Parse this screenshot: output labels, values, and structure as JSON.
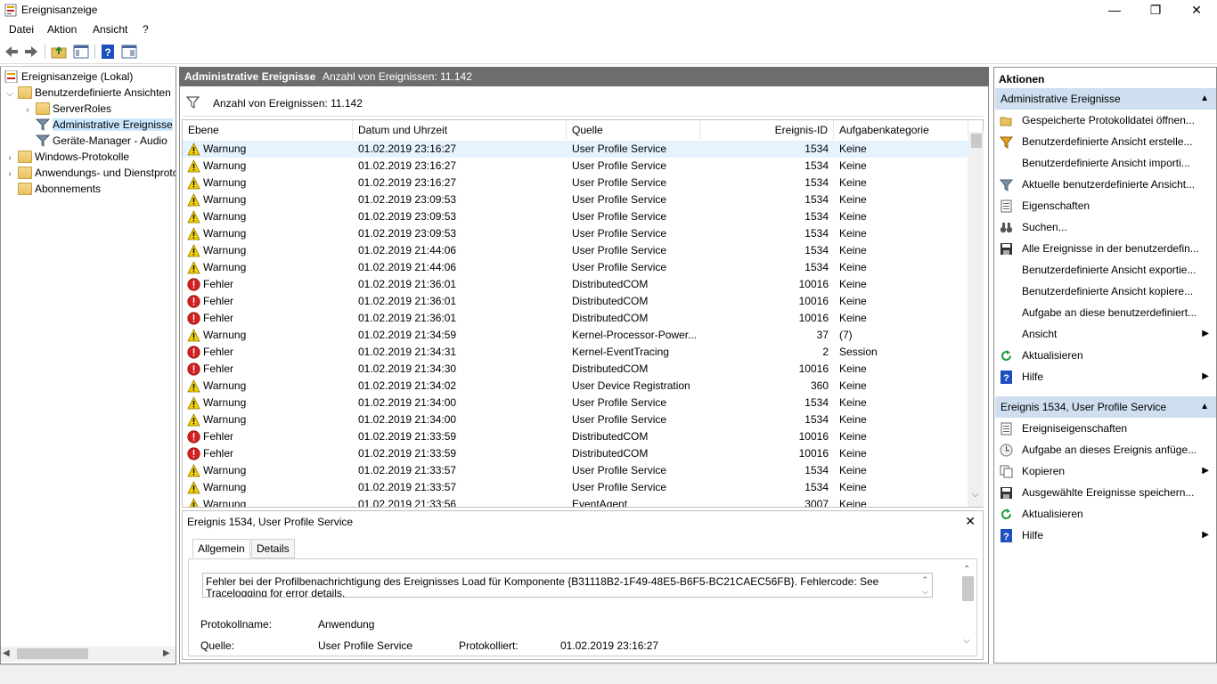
{
  "window": {
    "title": "Ereignisanzeige"
  },
  "menu": [
    "Datei",
    "Aktion",
    "Ansicht",
    "?"
  ],
  "tree": {
    "root": "Ereignisanzeige (Lokal)",
    "custom_views": "Benutzerdefinierte Ansichten",
    "server_roles": "ServerRoles",
    "admin_events": "Administrative Ereignisse",
    "device_manager": "Geräte-Manager - Audio",
    "windows_logs": "Windows-Protokolle",
    "app_logs": "Anwendungs- und Dienstprotokolle",
    "subscriptions": "Abonnements"
  },
  "center": {
    "title": "Administrative Ereignisse",
    "count_label": "Anzahl von Ereignissen: 11.142",
    "filter_text": "Anzahl von Ereignissen: 11.142",
    "columns": [
      "Ebene",
      "Datum und Uhrzeit",
      "Quelle",
      "Ereignis-ID",
      "Aufgabenkategorie"
    ],
    "rows": [
      {
        "level": "Warnung",
        "type": "warn",
        "date": "01.02.2019 23:16:27",
        "source": "User Profile Service",
        "id": "1534",
        "cat": "Keine"
      },
      {
        "level": "Warnung",
        "type": "warn",
        "date": "01.02.2019 23:16:27",
        "source": "User Profile Service",
        "id": "1534",
        "cat": "Keine"
      },
      {
        "level": "Warnung",
        "type": "warn",
        "date": "01.02.2019 23:16:27",
        "source": "User Profile Service",
        "id": "1534",
        "cat": "Keine"
      },
      {
        "level": "Warnung",
        "type": "warn",
        "date": "01.02.2019 23:09:53",
        "source": "User Profile Service",
        "id": "1534",
        "cat": "Keine"
      },
      {
        "level": "Warnung",
        "type": "warn",
        "date": "01.02.2019 23:09:53",
        "source": "User Profile Service",
        "id": "1534",
        "cat": "Keine"
      },
      {
        "level": "Warnung",
        "type": "warn",
        "date": "01.02.2019 23:09:53",
        "source": "User Profile Service",
        "id": "1534",
        "cat": "Keine"
      },
      {
        "level": "Warnung",
        "type": "warn",
        "date": "01.02.2019 21:44:06",
        "source": "User Profile Service",
        "id": "1534",
        "cat": "Keine"
      },
      {
        "level": "Warnung",
        "type": "warn",
        "date": "01.02.2019 21:44:06",
        "source": "User Profile Service",
        "id": "1534",
        "cat": "Keine"
      },
      {
        "level": "Fehler",
        "type": "err",
        "date": "01.02.2019 21:36:01",
        "source": "DistributedCOM",
        "id": "10016",
        "cat": "Keine"
      },
      {
        "level": "Fehler",
        "type": "err",
        "date": "01.02.2019 21:36:01",
        "source": "DistributedCOM",
        "id": "10016",
        "cat": "Keine"
      },
      {
        "level": "Fehler",
        "type": "err",
        "date": "01.02.2019 21:36:01",
        "source": "DistributedCOM",
        "id": "10016",
        "cat": "Keine"
      },
      {
        "level": "Warnung",
        "type": "warn",
        "date": "01.02.2019 21:34:59",
        "source": "Kernel-Processor-Power...",
        "id": "37",
        "cat": "(7)"
      },
      {
        "level": "Fehler",
        "type": "err",
        "date": "01.02.2019 21:34:31",
        "source": "Kernel-EventTracing",
        "id": "2",
        "cat": "Session"
      },
      {
        "level": "Fehler",
        "type": "err",
        "date": "01.02.2019 21:34:30",
        "source": "DistributedCOM",
        "id": "10016",
        "cat": "Keine"
      },
      {
        "level": "Warnung",
        "type": "warn",
        "date": "01.02.2019 21:34:02",
        "source": "User Device Registration",
        "id": "360",
        "cat": "Keine"
      },
      {
        "level": "Warnung",
        "type": "warn",
        "date": "01.02.2019 21:34:00",
        "source": "User Profile Service",
        "id": "1534",
        "cat": "Keine"
      },
      {
        "level": "Warnung",
        "type": "warn",
        "date": "01.02.2019 21:34:00",
        "source": "User Profile Service",
        "id": "1534",
        "cat": "Keine"
      },
      {
        "level": "Fehler",
        "type": "err",
        "date": "01.02.2019 21:33:59",
        "source": "DistributedCOM",
        "id": "10016",
        "cat": "Keine"
      },
      {
        "level": "Fehler",
        "type": "err",
        "date": "01.02.2019 21:33:59",
        "source": "DistributedCOM",
        "id": "10016",
        "cat": "Keine"
      },
      {
        "level": "Warnung",
        "type": "warn",
        "date": "01.02.2019 21:33:57",
        "source": "User Profile Service",
        "id": "1534",
        "cat": "Keine"
      },
      {
        "level": "Warnung",
        "type": "warn",
        "date": "01.02.2019 21:33:57",
        "source": "User Profile Service",
        "id": "1534",
        "cat": "Keine"
      },
      {
        "level": "Warnung",
        "type": "warn",
        "date": "01.02.2019 21:33:56",
        "source": "EventAgent",
        "id": "3007",
        "cat": "Keine"
      }
    ]
  },
  "detail": {
    "title": "Ereignis 1534, User Profile Service",
    "tab_general": "Allgemein",
    "tab_details": "Details",
    "message": "Fehler bei der Profilbenachrichtigung des Ereignisses Load für Komponente {B31118B2-1F49-48E5-B6F5-BC21CAEC56FB}. Fehlercode: See Tracelogging for error details.",
    "log_name_label": "Protokollname:",
    "log_name_value": "Anwendung",
    "source_label": "Quelle:",
    "source_value": "User Profile Service",
    "logged_label": "Protokolliert:",
    "logged_value": "01.02.2019 23:16:27"
  },
  "actions": {
    "title": "Aktionen",
    "section1": "Administrative Ereignisse",
    "items1": [
      {
        "label": "Gespeicherte Protokolldatei öffnen...",
        "icon": "folder-open-icon",
        "arrow": false
      },
      {
        "label": "Benutzerdefinierte Ansicht erstelle...",
        "icon": "filter-create-icon",
        "arrow": false
      },
      {
        "label": "Benutzerdefinierte Ansicht importi...",
        "icon": "",
        "arrow": false
      },
      {
        "label": "Aktuelle benutzerdefinierte Ansicht...",
        "icon": "filter-icon",
        "arrow": false
      },
      {
        "label": "Eigenschaften",
        "icon": "properties-icon",
        "arrow": false
      },
      {
        "label": "Suchen...",
        "icon": "binoculars-icon",
        "arrow": false
      },
      {
        "label": "Alle Ereignisse in der benutzerdefin...",
        "icon": "save-icon",
        "arrow": false
      },
      {
        "label": "Benutzerdefinierte Ansicht exportie...",
        "icon": "",
        "arrow": false
      },
      {
        "label": "Benutzerdefinierte Ansicht kopiere...",
        "icon": "",
        "arrow": false
      },
      {
        "label": "Aufgabe an diese benutzerdefiniert...",
        "icon": "",
        "arrow": false
      },
      {
        "label": "Ansicht",
        "icon": "",
        "arrow": true
      },
      {
        "label": "Aktualisieren",
        "icon": "refresh-icon",
        "arrow": false
      },
      {
        "label": "Hilfe",
        "icon": "help-icon",
        "arrow": true
      }
    ],
    "section2": "Ereignis 1534, User Profile Service",
    "items2": [
      {
        "label": "Ereigniseigenschaften",
        "icon": "properties-icon",
        "arrow": false
      },
      {
        "label": "Aufgabe an dieses Ereignis anfüge...",
        "icon": "task-icon",
        "arrow": false
      },
      {
        "label": "Kopieren",
        "icon": "copy-icon",
        "arrow": true
      },
      {
        "label": "Ausgewählte Ereignisse speichern...",
        "icon": "save-icon",
        "arrow": false
      },
      {
        "label": "Aktualisieren",
        "icon": "refresh-icon",
        "arrow": false
      },
      {
        "label": "Hilfe",
        "icon": "help-icon",
        "arrow": true
      }
    ]
  },
  "colors": {
    "accent_header": "#6d6d6d",
    "section_header": "#cfdff0",
    "selection": "#cce8ff",
    "warning": "#f5d000",
    "error": "#d42020"
  }
}
